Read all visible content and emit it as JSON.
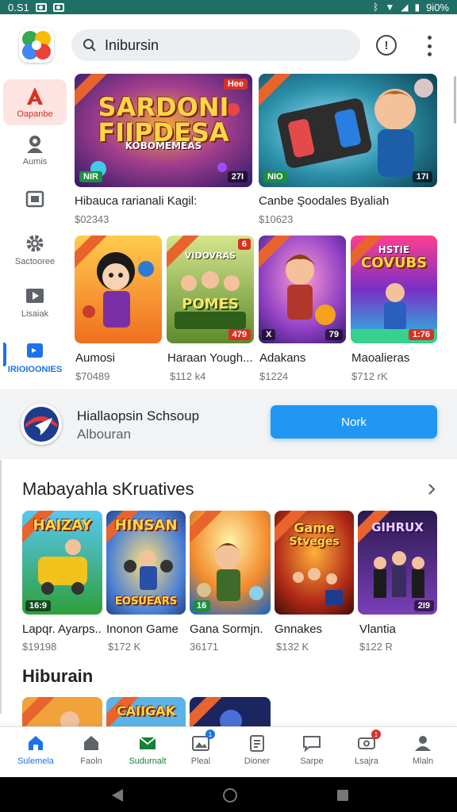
{
  "status_bar": {
    "time": "0.S1",
    "battery": "9i0%"
  },
  "search": {
    "value": "Inibursin"
  },
  "rail": {
    "items": [
      {
        "label": "Oapanbe",
        "icon": "app-store-icon"
      },
      {
        "label": "Aumis",
        "icon": "profile-icon"
      },
      {
        "label": "",
        "icon": "window-icon"
      },
      {
        "label": "Sactooree",
        "icon": "gear-icon"
      },
      {
        "label": "Lisaiak",
        "icon": "play-icon"
      },
      {
        "label": "IRIOIOONIES",
        "icon": "badge-icon"
      }
    ]
  },
  "featured": [
    {
      "title": "Hibauca rarianali Kagil:",
      "price": "$02343",
      "logo_text": "SARDONI FIIPDESA",
      "logo_sub": "KOBOMEMEAS",
      "tag_left": "NIR",
      "tag_right": "27I",
      "badge": "Hee"
    },
    {
      "title": "Canbe Şoodales Byaliah",
      "price": "$10623",
      "tag_left": "NIO",
      "tag_right": "17I"
    }
  ],
  "grid": [
    {
      "title": "Aumosi",
      "price": "$70489",
      "tag_left": "",
      "tag_right": ""
    },
    {
      "title": "Haraan Yough...",
      "price": "$112 k4",
      "logo_text": "POMES",
      "logo_sub": "VIDOVRAS",
      "badge": "6",
      "tag_right": "479"
    },
    {
      "title": "Adakans",
      "price": "$1224",
      "tag_left": "X",
      "tag_right": "79"
    },
    {
      "title": "Maoalieras",
      "price": "$712 rK",
      "logo_text": "COVUBS",
      "logo_sub": "HSTIE",
      "tag_right": "1:76"
    }
  ],
  "promo": {
    "title": "Hiallaopsin Schsoup",
    "subtitle": "Albouran",
    "button": "Nork"
  },
  "section1": {
    "title": "Mabayahla sKruatives",
    "items": [
      {
        "title": "Lapqr. Ayarps..",
        "price": "$19198",
        "logo_text": "HAIZAY",
        "tag": "16:9"
      },
      {
        "title": "Inonon Game",
        "price": "$172 K",
        "logo_text": "HINSAN",
        "logo_sub": "EOSUEARS"
      },
      {
        "title": "Gana Sormjn.",
        "price": "36171",
        "tag": "16"
      },
      {
        "title": "Gnnakes",
        "price": "$132 K",
        "logo_text": "Game",
        "logo_sub": "Stveges"
      },
      {
        "title": "Vlantia",
        "price": "$122 R",
        "logo_text": "GIHRUX",
        "tag": "2I9"
      }
    ]
  },
  "section2": {
    "title": "Hiburain",
    "logo_text": "CAIIGAK"
  },
  "bottom_nav": [
    {
      "label": "Sulemela",
      "icon": "home-icon"
    },
    {
      "label": "Faoln",
      "icon": "house-icon"
    },
    {
      "label": "Sudurnalt",
      "icon": "mail-icon"
    },
    {
      "label": "Pleal",
      "icon": "gallery-icon",
      "badge": "1"
    },
    {
      "label": "Dioner",
      "icon": "document-icon"
    },
    {
      "label": "Sarpe",
      "icon": "chat-icon"
    },
    {
      "label": "Lsajra",
      "icon": "ticket-icon",
      "badge": "1"
    },
    {
      "label": "Mlaln",
      "icon": "person-icon"
    }
  ],
  "colors": {
    "accent": "#1a73e8",
    "status_bar": "#1f6f66",
    "promo_button": "#2196f3",
    "rail_active": "#d93025"
  }
}
